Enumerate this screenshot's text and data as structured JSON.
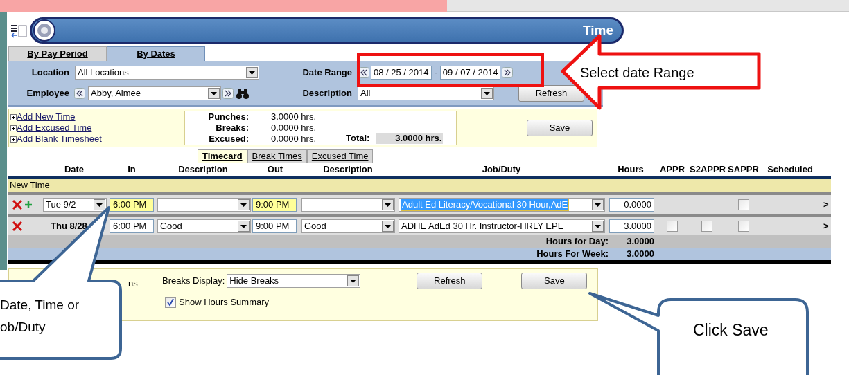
{
  "header": {
    "title": "Time"
  },
  "view_tabs": [
    {
      "label": "By Pay Period",
      "selected": false
    },
    {
      "label": "By Dates",
      "selected": true
    }
  ],
  "filters": {
    "location": {
      "label": "Location",
      "value": "All Locations"
    },
    "date_range": {
      "label": "Date Range",
      "from": "08 / 25 / 2014",
      "separator": "-",
      "to": "09 / 07 / 2014"
    },
    "employee": {
      "label": "Employee",
      "value": "Abby, Aimee"
    },
    "description": {
      "label": "Description",
      "value": "All"
    },
    "refresh_button": "Refresh"
  },
  "actions": {
    "links": [
      "Add New Time",
      "Add Excused Time",
      "Add Blank Timesheet"
    ],
    "summary": [
      {
        "label": "Punches:",
        "value": "3.0000 hrs."
      },
      {
        "label": "Breaks:",
        "value": "0.0000 hrs."
      },
      {
        "label": "Excused:",
        "value": "0.0000 hrs."
      }
    ],
    "total": {
      "label": "Total:",
      "value": "3.0000 hrs."
    },
    "save_button": "Save"
  },
  "sub_tabs": [
    {
      "label": "Timecard",
      "selected": true
    },
    {
      "label": "Break Times",
      "selected": false
    },
    {
      "label": "Excused Time",
      "selected": false
    }
  ],
  "columns": [
    "Date",
    "In",
    "Description",
    "Out",
    "Description",
    "Job/Duty",
    "Hours",
    "APPR",
    "S2APPR",
    "SAPPR",
    "Scheduled"
  ],
  "group_label": "New Time",
  "rows": [
    {
      "kind": "new",
      "date": "Tue 9/2",
      "in": "6:00 PM",
      "in_highlighted": true,
      "out": "9:00 PM",
      "out_highlighted": true,
      "job": "Adult Ed Literacy/Vocational 30 Hour,AdE",
      "job_selected": true,
      "hours": "0.0000",
      "approvals": {
        "sappr": false
      },
      "more": ">"
    },
    {
      "kind": "saved",
      "date": "Thu 8/28",
      "in": "6:00 PM",
      "in_highlighted": false,
      "in_description": "Good",
      "out": "9:00 PM",
      "out_highlighted": false,
      "out_description": "Good",
      "job": "ADHE AdEd 30 Hr. Instructor-HRLY EPE",
      "job_selected": false,
      "hours": "3.0000",
      "approvals": {
        "appr": false,
        "s2appr": false,
        "sappr": false
      },
      "more": ">"
    }
  ],
  "totals": [
    {
      "label": "Hours for Day:",
      "value": "3.0000"
    },
    {
      "label": "Hours For Week:",
      "value": "3.0000"
    }
  ],
  "bottom": {
    "fragment": "ns",
    "breaks_display": {
      "label": "Breaks Display:",
      "value": "Hide Breaks"
    },
    "show_hours_summary": {
      "label": "Show Hours Summary",
      "checked": true
    },
    "refresh_button": "Refresh",
    "save_button": "Save"
  },
  "callouts": [
    {
      "kind": "arrow",
      "lines": [
        "Select date Range"
      ]
    },
    {
      "kind": "bubble",
      "lines": [
        "Date, Time or",
        "ob/Duty"
      ]
    },
    {
      "kind": "bubble",
      "lines": [
        "Click Save"
      ]
    }
  ]
}
